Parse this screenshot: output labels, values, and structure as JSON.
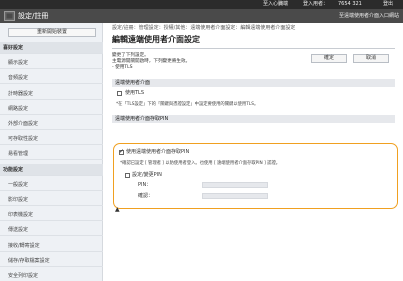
{
  "topbar": {
    "items": [
      "至入心臓端",
      "登入用者：",
      "7654 321",
      "登出"
    ]
  },
  "header": {
    "title": "設定/註冊",
    "portal_link": "至遠端使用者介面入口網站"
  },
  "sidebar": {
    "restart_button": "重新開始裝置",
    "items": [
      {
        "label": "喜好設定",
        "type": "section"
      },
      {
        "label": "顯示設定",
        "type": "sub"
      },
      {
        "label": "音頻設定",
        "type": "sub"
      },
      {
        "label": "計時器設定",
        "type": "sub"
      },
      {
        "label": "網路設定",
        "type": "sub"
      },
      {
        "label": "外部介面設定",
        "type": "sub"
      },
      {
        "label": "可存取性設定",
        "type": "sub"
      },
      {
        "label": "易看管理",
        "type": "sub"
      },
      {
        "label": "功能設定",
        "type": "section"
      },
      {
        "label": "一般設定",
        "type": "sub"
      },
      {
        "label": "影印設定",
        "type": "sub"
      },
      {
        "label": "印表機設定",
        "type": "sub"
      },
      {
        "label": "傳送設定",
        "type": "sub"
      },
      {
        "label": "接收/轉寄設定",
        "type": "sub"
      },
      {
        "label": "儲存/存取檔案設定",
        "type": "sub"
      },
      {
        "label": "安全列印設定",
        "type": "sub"
      }
    ]
  },
  "main": {
    "breadcrumb": "設定/註冊：管理設定：授權/其他：遠端使用者介面設定：編輯遠端使用者介面設定",
    "title": "編輯遠端使用者介面設定",
    "intro_lines": [
      "變更了下列設定。",
      "主電源開關開啟時，下列變更將生效。",
      "- 使用TLS"
    ],
    "ok_button": "確定",
    "cancel_button": "取消",
    "section1": {
      "heading": "遠端使用者介面",
      "checkbox_label": "使用TLS",
      "checked": false,
      "note": "*在「TLS設定」下的「關鍵與憑證設定」中設定要使用的關鍵以使用TLS。"
    },
    "section2": {
      "heading": "遠端使用者介面存取PIN",
      "checkbox_label": "使用遠端使用者介面存取PIN",
      "checked": true,
      "note": "*確認已設定 [ 管理者 ] 以防使用者登入。也使用 [ 遠端使用者介面存取PIN ] 認證。",
      "sub_checkbox_label": "設定/變更PIN",
      "sub_checked": false,
      "pin_label": "PIN：",
      "confirm_label": "確認："
    }
  },
  "icons": {
    "logo": "canon-logo-icon",
    "back_to_top": "up-arrow-icon"
  },
  "colors": {
    "highlight": "#f0a020",
    "topbar": "#2b2b2b",
    "header": "#4a4a4a"
  }
}
